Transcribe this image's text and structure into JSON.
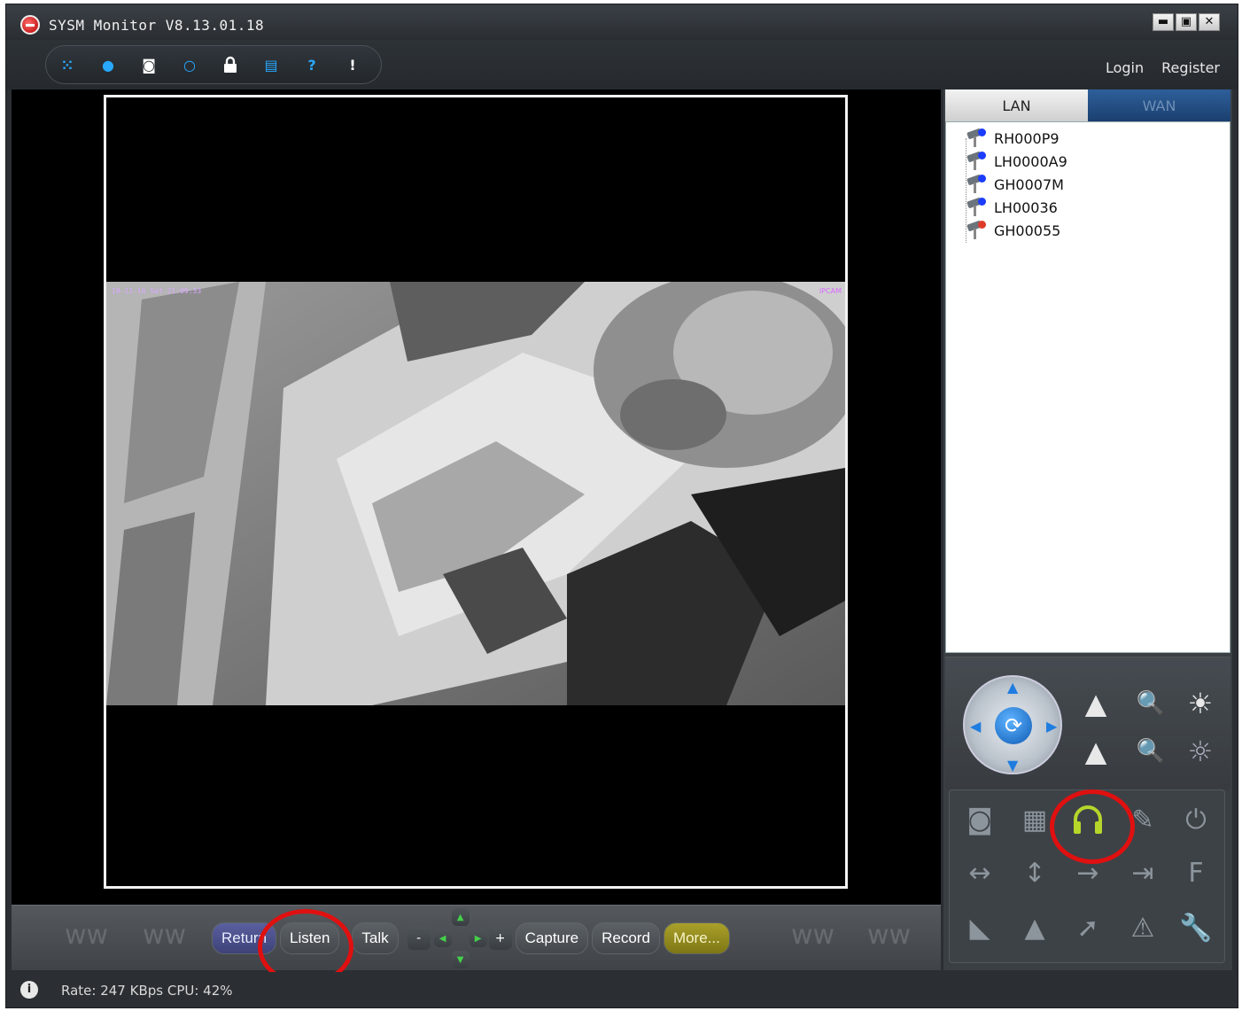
{
  "window": {
    "title": "SYSM Monitor  V8.13.01.18",
    "min_label": "▬",
    "max_label": "▣",
    "close_label": "✕"
  },
  "toolbar": {
    "icons": [
      "grid-icon",
      "record-icon",
      "camera-icon",
      "search-icon",
      "lock-icon",
      "save-icon",
      "help-icon",
      "alert-icon"
    ],
    "glyphs": [
      "⁙",
      "●",
      "◙",
      "○",
      "🔒",
      "▤",
      "?",
      "!"
    ],
    "colors": [
      "#28a9ff",
      "#28a9ff",
      "#ffffff",
      "#28a9ff",
      "#ffffff",
      "#28a9ff",
      "#28a9ff",
      "#ffffff"
    ],
    "login_label": "Login",
    "register_label": "Register"
  },
  "video": {
    "osd_text": "19-11-16 Sat 21:09:33",
    "osd_right": "IPCAM"
  },
  "controls": {
    "return_label": "Return",
    "listen_label": "Listen",
    "talk_label": "Talk",
    "minus_label": "-",
    "plus_label": "+",
    "capture_label": "Capture",
    "record_label": "Record",
    "more_label": "More..."
  },
  "status": {
    "text": "Rate: 247 KBps  CPU:  42%"
  },
  "panel": {
    "tab_lan": "LAN",
    "tab_wan": "WAN",
    "devices": [
      {
        "name": "RH000P9",
        "led": "#1a3cff"
      },
      {
        "name": "LH0000A9",
        "led": "#1a3cff"
      },
      {
        "name": "GH0007M",
        "led": "#1a3cff"
      },
      {
        "name": "LH00036",
        "led": "#1a3cff"
      },
      {
        "name": "GH00055",
        "led": "#e03a2a"
      }
    ]
  },
  "accent": {
    "highlight": "#e01010",
    "wan_tab": "#1f4a80"
  }
}
